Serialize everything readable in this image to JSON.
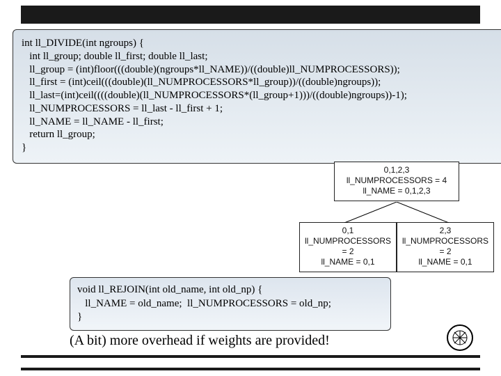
{
  "code": {
    "l1": "int ll_DIVIDE(int ngroups) {",
    "l2": "   int ll_group; double ll_first; double ll_last;",
    "l3": "   ll_group = (int)floor(((double)(ngroups*ll_NAME))/((double)ll_NUMPROCESSORS));",
    "l4": "   ll_first = (int)ceil(((double)(ll_NUMPROCESSORS*ll_group))/((double)ngroups));",
    "l5": "   ll_last=(int)ceil((((double)(ll_NUMPROCESSORS*(ll_group+1)))/((double)ngroups))-1);",
    "l6": "   ll_NUMPROCESSORS = ll_last - ll_first + 1;",
    "l7": "   ll_NAME = ll_NAME - ll_first;",
    "l8": "   return ll_group;",
    "l9": "}"
  },
  "rejoin": {
    "l1": "void ll_REJOIN(int old_name, int old_np) {",
    "l2": "   ll_NAME = old_name;  ll_NUMPROCESSORS = old_np;",
    "l3": "}"
  },
  "diagram": {
    "root": {
      "ids": "0,1,2,3",
      "np": "ll_NUMPROCESSORS = 4",
      "name": "ll_NAME = 0,1,2,3"
    },
    "left": {
      "ids": "0,1",
      "np": "ll_NUMPROCESSORS = 2",
      "name": "ll_NAME = 0,1"
    },
    "right": {
      "ids": "2,3",
      "np": "ll_NUMPROCESSORS = 2",
      "name": "ll_NAME = 0,1"
    }
  },
  "caption": "(A bit) more overhead if weights are provided!"
}
